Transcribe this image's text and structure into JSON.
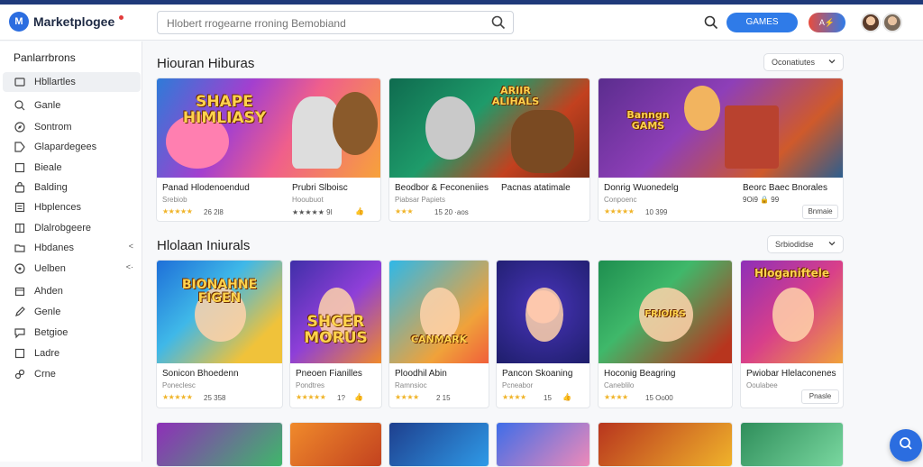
{
  "header": {
    "logo_text": "Marketplogee",
    "logo_glyph": "M",
    "search_placeholder": "Hlobert rrogearne rroning Bemobiand",
    "primary_button": "GAMES",
    "pill_button": "A⚡"
  },
  "sidebar": {
    "title": "Panlarrbrons",
    "items": [
      {
        "label": "Hbllartles",
        "icon": "home-icon",
        "active": true
      },
      {
        "label": "Ganle",
        "icon": "search-icon"
      },
      {
        "label": "Sontrom",
        "icon": "compass-icon"
      },
      {
        "label": "Glapardegees",
        "icon": "tag-icon"
      },
      {
        "label": "Bieale",
        "icon": "square-icon"
      },
      {
        "label": "Balding",
        "icon": "shopping-bag-icon"
      },
      {
        "label": "Hbplences",
        "icon": "list-icon"
      },
      {
        "label": "Dlalrobgeere",
        "icon": "grid-icon"
      },
      {
        "label": "Hbdanes",
        "icon": "folder-icon",
        "arrow": "<"
      },
      {
        "label": "Uelben",
        "icon": "circle-icon",
        "arrow": "<·"
      },
      {
        "label": "Ahden",
        "icon": "box-icon"
      },
      {
        "label": "Genle",
        "icon": "pen-icon"
      },
      {
        "label": "Betgioe",
        "icon": "chat-icon"
      },
      {
        "label": "Ladre",
        "icon": "square-icon"
      },
      {
        "label": "Crne",
        "icon": "link-icon"
      }
    ]
  },
  "section1": {
    "title": "Hiouran Hiburas",
    "select": "Oconatiutes",
    "cards": [
      {
        "thumb_title": "SHAPE\nHIMLIASY",
        "caption": "Panad Hlodenoendud",
        "caption2": "Prubri Slboisc",
        "sub": "Srebiob",
        "sub2": "Hooubuot",
        "stars": "★★★★★",
        "meta": "26 2l8",
        "meta2": "★★★★★ 9l",
        "thumbs": "👍"
      },
      {
        "thumb_title": "ARIIR\nALIHALS",
        "caption": "Beodbor & Feconeniies",
        "caption2": "Pacnas atatimale",
        "sub": "Piabsar Papiets",
        "stars": "★★★",
        "meta": "15 20 ·aos"
      },
      {
        "thumb_title": "Banngn\nGAMS",
        "caption": "Donrig Wuonedelg",
        "caption2": "Beorc Baec Bnorales",
        "sub": "Conpoenc",
        "sub2": "9Oi9 🔒 99",
        "stars": "★★★★★",
        "meta": "10 399",
        "button": "Bnmaie"
      }
    ]
  },
  "section2": {
    "title": "Hlolaan Iniurals",
    "select": "Srbiodidse",
    "cards": [
      {
        "thumb_title": "BIONAHNE\nFIGEN",
        "caption": "Sonicon Bhoedenn",
        "sub": "Poneclesc",
        "stars": "★★★★★",
        "meta": "25 358"
      },
      {
        "thumb_title": "SHCER\nMORUS",
        "caption": "Pneoen Fianilles",
        "sub": "Pondtres",
        "stars": "★★★★★",
        "meta": "1?",
        "thumbs": "👍"
      },
      {
        "thumb_title": "CANMARK",
        "caption": "Ploodhil Abin",
        "sub": "Ramnsioc",
        "stars": "★★★★",
        "meta": "2 15"
      },
      {
        "thumb_title": "",
        "caption": "Pancon Skoaning",
        "sub": "Pcneabor",
        "stars": "★★★★",
        "meta": "15",
        "thumbs": "👍"
      },
      {
        "thumb_title": "FRIOIRS",
        "caption": "Hoconig Beagring",
        "sub": "Caneblilo",
        "stars": "★★★★",
        "meta": "15 Oo00"
      },
      {
        "thumb_title": "Hloganiftele",
        "caption": "Pwiobar Hlelaconenes",
        "sub": "Ooulabee",
        "button": "Pnasle"
      }
    ]
  },
  "colors": {
    "accent": "#2f7be8",
    "star": "#f0b429",
    "sidebar_active": "#eef0f3"
  }
}
